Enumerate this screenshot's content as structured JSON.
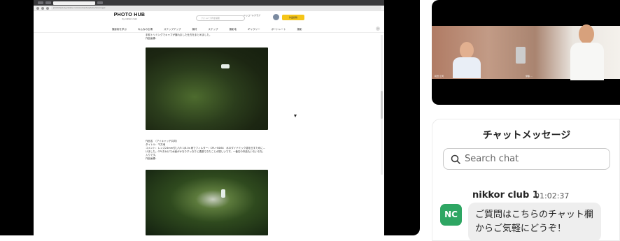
{
  "browser": {
    "url": "photohub.by.nikkor.com/contents/photo/sharing/x",
    "tab_title": "Photo Hub - ..."
  },
  "site": {
    "logo": "PHOTO HUB",
    "logo_sub": "by nikkor club",
    "search_placeholder": "フォトハブ内を検索",
    "user_name": "ニッコールクラブ",
    "post_button": "作品投稿",
    "menu": [
      "撮影術を学ぶ",
      "みんなの広場",
      "ステップアップ",
      "機材",
      "ステップ",
      "撮影地",
      "ギャラリー",
      "ボートレート",
      "撮影"
    ],
    "next_arrow": "›"
  },
  "article": {
    "intro": "手前トリミングでキャプが撮れました仕方をまとめました。",
    "photo_label_1": "作品画像：",
    "section_title": "作品名　（アイキャッチ共同）",
    "title_line": "タイトル：千方滝",
    "comment_line": "コメント：レンズ24mm付しF/5 1/8.0s 雨でフィルター：CPL+ND64　水のダイナミック感を出すために…",
    "comment_line2": "けました。CPLおかげで水面がかなりすっきりと透過できたことが嬉しいです。一番右の作品もいろいろな。",
    "comment_line3": "入りです。",
    "photo_label_2": "作品画像："
  },
  "video": {
    "participant_left": "和田 江司",
    "participant_right": "伊藤 …"
  },
  "chat": {
    "title": "チャットメッセージ",
    "search_placeholder": "Search chat",
    "messages": [
      {
        "author": "nikkor club 1",
        "time": "01:02:37",
        "avatar_initials": "NC",
        "text": "ご質問はこちらのチャット欄からご気軽にどうぞ！"
      }
    ]
  },
  "colors": {
    "accent_avatar": "#2ea663",
    "post_button": "#f5c518"
  }
}
